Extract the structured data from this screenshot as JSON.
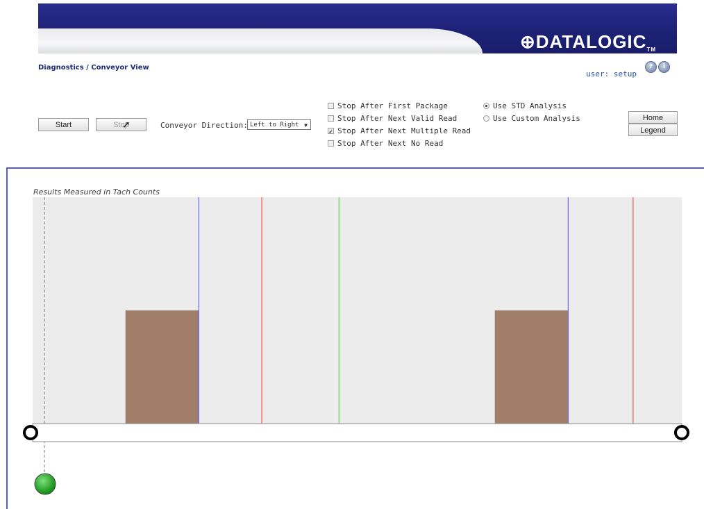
{
  "brand": {
    "logo_text": "DATALOGIC",
    "logo_mark": "⊕",
    "tm": "TM"
  },
  "breadcrumb": "Diagnostics / Conveyor View",
  "user_label": "user: setup",
  "icons": {
    "help": "help-icon",
    "info": "info-icon"
  },
  "controls": {
    "start_label": "Start",
    "stop_label": "Stop",
    "direction_label": "Conveyor Direction:",
    "direction_value": "Left to Right",
    "home_label": "Home",
    "legend_label": "Legend"
  },
  "checkboxes": [
    {
      "label": "Stop After First Package",
      "checked": false
    },
    {
      "label": "Stop After Next Valid Read",
      "checked": false
    },
    {
      "label": "Stop After Next Multiple Read",
      "checked": true
    },
    {
      "label": "Stop After Next No Read",
      "checked": false
    }
  ],
  "analysis": [
    {
      "label": "Use STD Analysis",
      "selected": true
    },
    {
      "label": "Use Custom Analysis",
      "selected": false
    }
  ],
  "chart_data": {
    "type": "bar",
    "title": "Results Measured in Tach Counts",
    "x_range": [
      0,
      1000
    ],
    "y_range": [
      0,
      100
    ],
    "packages": [
      {
        "start": 143,
        "end": 256,
        "height": 50
      },
      {
        "start": 712,
        "end": 825,
        "height": 50
      }
    ],
    "vlines": [
      {
        "x": 256,
        "color": "#6666ee"
      },
      {
        "x": 353,
        "color": "#ee5555"
      },
      {
        "x": 472,
        "color": "#55dd55"
      },
      {
        "x": 825,
        "color": "#6666ee"
      },
      {
        "x": 925,
        "color": "#ee5555"
      }
    ],
    "package_color": "#a07e6a",
    "area_color": "#ececec"
  },
  "status": {
    "indicator_color": "#22aa22"
  }
}
